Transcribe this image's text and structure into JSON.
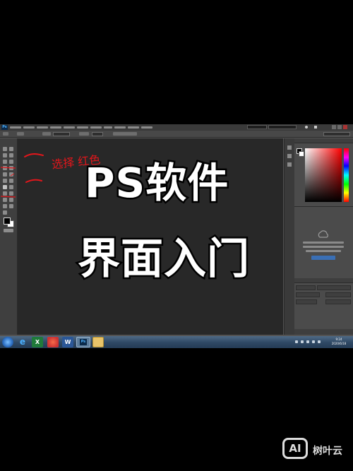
{
  "app": {
    "logo_text": "Ps"
  },
  "menu_bar": {
    "items": [
      "",
      "",
      "",
      "",
      "",
      "",
      "",
      "",
      "",
      "",
      ""
    ]
  },
  "options_bar": {
    "controls": [
      "",
      "",
      "",
      "",
      ""
    ]
  },
  "overlay": {
    "line1": "PS软件",
    "line2": "界面入门"
  },
  "annotations": {
    "handwriting": "选择 红色"
  },
  "right_panel": {
    "cloud_lines": [
      "",
      "",
      ""
    ],
    "cloud_button": ""
  },
  "taskbar": {
    "apps": [
      "windows-start",
      "internet-explorer",
      "excel",
      "app-red-circle",
      "word",
      "photoshop",
      "file-explorer"
    ],
    "time": "9:24",
    "date": "2020/6/18"
  },
  "watermark": {
    "logo": "AI",
    "text": "树叶云"
  },
  "colors": {
    "annotation_red": "#e3161b",
    "workspace": "#282828",
    "panel": "#4b4b4b"
  }
}
